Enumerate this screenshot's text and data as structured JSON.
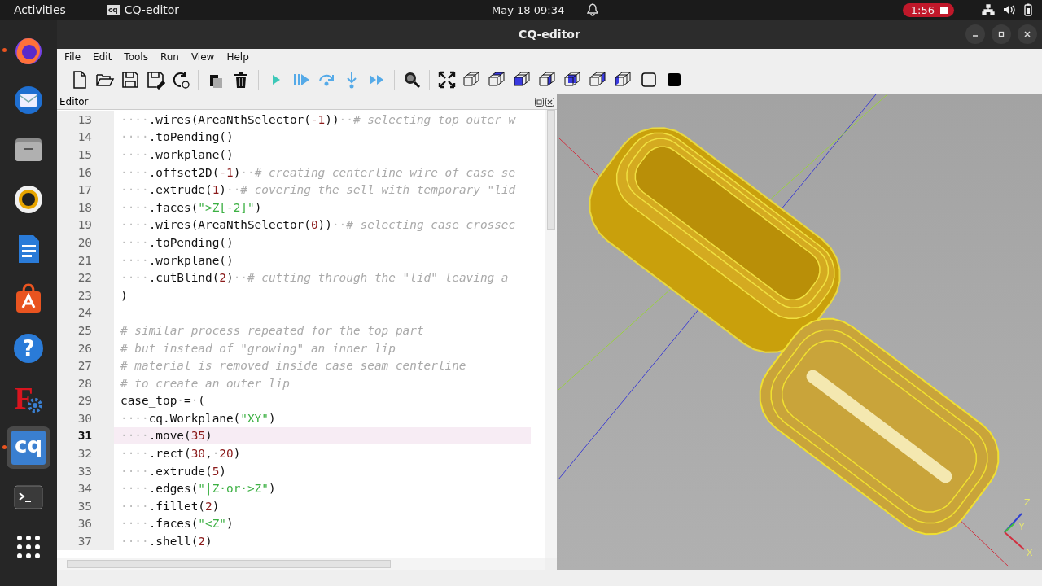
{
  "top_bar": {
    "activities": "Activities",
    "app_name": "CQ-editor",
    "app_icon_text": "cq",
    "clock": "May 18  09:34",
    "recording_time": "1:56"
  },
  "dock": [
    {
      "kind": "firefox",
      "running": true,
      "selected": false
    },
    {
      "kind": "mail",
      "running": false,
      "selected": false
    },
    {
      "kind": "files",
      "running": false,
      "selected": false
    },
    {
      "kind": "speaker",
      "running": false,
      "selected": false
    },
    {
      "kind": "writer",
      "running": false,
      "selected": false
    },
    {
      "kind": "store",
      "running": false,
      "selected": false
    },
    {
      "kind": "help",
      "label": "?",
      "running": false,
      "selected": false
    },
    {
      "kind": "freecad",
      "label": "F",
      "running": false,
      "selected": false
    },
    {
      "kind": "cq",
      "label": "cq",
      "running": true,
      "selected": true
    },
    {
      "kind": "terminal",
      "running": false,
      "selected": false
    },
    {
      "kind": "apps",
      "running": false,
      "selected": false
    }
  ],
  "window": {
    "title": "CQ-editor"
  },
  "menu": [
    "File",
    "Edit",
    "Tools",
    "Run",
    "View",
    "Help"
  ],
  "editor": {
    "title": "Editor",
    "lines": [
      {
        "number": "13",
        "current": false,
        "segments": [
          {
            "kind": "dots",
            "text": "····"
          },
          {
            "kind": "plain",
            "text": ".wires(AreaNthSelector("
          },
          {
            "kind": "number",
            "text": "-1"
          },
          {
            "kind": "plain",
            "text": "))"
          },
          {
            "kind": "dots",
            "text": "··"
          },
          {
            "kind": "comment",
            "text": "# selecting top outer w"
          }
        ]
      },
      {
        "number": "14",
        "current": false,
        "segments": [
          {
            "kind": "dots",
            "text": "····"
          },
          {
            "kind": "plain",
            "text": ".toPending()"
          }
        ]
      },
      {
        "number": "15",
        "current": false,
        "segments": [
          {
            "kind": "dots",
            "text": "····"
          },
          {
            "kind": "plain",
            "text": ".workplane()"
          }
        ]
      },
      {
        "number": "16",
        "current": false,
        "segments": [
          {
            "kind": "dots",
            "text": "····"
          },
          {
            "kind": "plain",
            "text": ".offset2D("
          },
          {
            "kind": "number",
            "text": "-1"
          },
          {
            "kind": "plain",
            "text": ")"
          },
          {
            "kind": "dots",
            "text": "··"
          },
          {
            "kind": "comment",
            "text": "# creating centerline wire of case se"
          }
        ]
      },
      {
        "number": "17",
        "current": false,
        "segments": [
          {
            "kind": "dots",
            "text": "····"
          },
          {
            "kind": "plain",
            "text": ".extrude("
          },
          {
            "kind": "number",
            "text": "1"
          },
          {
            "kind": "plain",
            "text": ")"
          },
          {
            "kind": "dots",
            "text": "··"
          },
          {
            "kind": "comment",
            "text": "# covering the sell with temporary \"lid"
          }
        ]
      },
      {
        "number": "18",
        "current": false,
        "segments": [
          {
            "kind": "dots",
            "text": "····"
          },
          {
            "kind": "plain",
            "text": ".faces("
          },
          {
            "kind": "string",
            "text": "\">Z[-2]\""
          },
          {
            "kind": "plain",
            "text": ")"
          }
        ]
      },
      {
        "number": "19",
        "current": false,
        "segments": [
          {
            "kind": "dots",
            "text": "····"
          },
          {
            "kind": "plain",
            "text": ".wires(AreaNthSelector("
          },
          {
            "kind": "number",
            "text": "0"
          },
          {
            "kind": "plain",
            "text": "))"
          },
          {
            "kind": "dots",
            "text": "··"
          },
          {
            "kind": "comment",
            "text": "# selecting case crossec"
          }
        ]
      },
      {
        "number": "20",
        "current": false,
        "segments": [
          {
            "kind": "dots",
            "text": "····"
          },
          {
            "kind": "plain",
            "text": ".toPending()"
          }
        ]
      },
      {
        "number": "21",
        "current": false,
        "segments": [
          {
            "kind": "dots",
            "text": "····"
          },
          {
            "kind": "plain",
            "text": ".workplane()"
          }
        ]
      },
      {
        "number": "22",
        "current": false,
        "segments": [
          {
            "kind": "dots",
            "text": "····"
          },
          {
            "kind": "plain",
            "text": ".cutBlind("
          },
          {
            "kind": "number",
            "text": "2"
          },
          {
            "kind": "plain",
            "text": ")"
          },
          {
            "kind": "dots",
            "text": "··"
          },
          {
            "kind": "comment",
            "text": "# cutting through the \"lid\" leaving a"
          }
        ]
      },
      {
        "number": "23",
        "current": false,
        "segments": [
          {
            "kind": "plain",
            "text": ")"
          }
        ]
      },
      {
        "number": "24",
        "current": false
      },
      {
        "number": "25",
        "current": false,
        "segments": [
          {
            "kind": "comment",
            "text": "# similar process repeated for the top part"
          }
        ]
      },
      {
        "number": "26",
        "current": false,
        "segments": [
          {
            "kind": "comment",
            "text": "# but instead of \"growing\" an inner lip"
          }
        ]
      },
      {
        "number": "27",
        "current": false,
        "segments": [
          {
            "kind": "comment",
            "text": "# material is removed inside case seam centerline"
          }
        ]
      },
      {
        "number": "28",
        "current": false,
        "segments": [
          {
            "kind": "comment",
            "text": "# to create an outer lip"
          }
        ]
      },
      {
        "number": "29",
        "current": false,
        "segments": [
          {
            "kind": "plain",
            "text": "case_top"
          },
          {
            "kind": "dots",
            "text": "·"
          },
          {
            "kind": "plain",
            "text": "="
          },
          {
            "kind": "dots",
            "text": "·"
          },
          {
            "kind": "plain",
            "text": "("
          }
        ]
      },
      {
        "number": "30",
        "current": false,
        "segments": [
          {
            "kind": "dots",
            "text": "····"
          },
          {
            "kind": "plain",
            "text": "cq.Workplane("
          },
          {
            "kind": "string",
            "text": "\"XY\""
          },
          {
            "kind": "plain",
            "text": ")"
          }
        ]
      },
      {
        "number": "31",
        "current": true,
        "segments": [
          {
            "kind": "dots",
            "text": "····"
          },
          {
            "kind": "plain",
            "text": ".move("
          },
          {
            "kind": "number",
            "text": "35"
          },
          {
            "kind": "plain",
            "text": ")"
          }
        ]
      },
      {
        "number": "32",
        "current": false,
        "segments": [
          {
            "kind": "dots",
            "text": "····"
          },
          {
            "kind": "plain",
            "text": ".rect("
          },
          {
            "kind": "number",
            "text": "30"
          },
          {
            "kind": "plain",
            "text": ","
          },
          {
            "kind": "dots",
            "text": "·"
          },
          {
            "kind": "number",
            "text": "20"
          },
          {
            "kind": "plain",
            "text": ")"
          }
        ]
      },
      {
        "number": "33",
        "current": false,
        "segments": [
          {
            "kind": "dots",
            "text": "····"
          },
          {
            "kind": "plain",
            "text": ".extrude("
          },
          {
            "kind": "number",
            "text": "5"
          },
          {
            "kind": "plain",
            "text": ")"
          }
        ]
      },
      {
        "number": "34",
        "current": false,
        "segments": [
          {
            "kind": "dots",
            "text": "····"
          },
          {
            "kind": "plain",
            "text": ".edges("
          },
          {
            "kind": "string",
            "text": "\"|Z·or·>Z\""
          },
          {
            "kind": "plain",
            "text": ")"
          }
        ]
      },
      {
        "number": "35",
        "current": false,
        "segments": [
          {
            "kind": "dots",
            "text": "····"
          },
          {
            "kind": "plain",
            "text": ".fillet("
          },
          {
            "kind": "number",
            "text": "2"
          },
          {
            "kind": "plain",
            "text": ")"
          }
        ]
      },
      {
        "number": "36",
        "current": false,
        "segments": [
          {
            "kind": "dots",
            "text": "····"
          },
          {
            "kind": "plain",
            "text": ".faces("
          },
          {
            "kind": "string",
            "text": "\"<Z\""
          },
          {
            "kind": "plain",
            "text": ")"
          }
        ]
      },
      {
        "number": "37",
        "current": false,
        "segments": [
          {
            "kind": "dots",
            "text": "····"
          },
          {
            "kind": "plain",
            "text": ".shell("
          },
          {
            "kind": "number",
            "text": "2"
          },
          {
            "kind": "plain",
            "text": ")"
          }
        ]
      }
    ]
  },
  "viewer": {
    "axis_labels": {
      "z": "Z",
      "y": "Y",
      "x": "X"
    }
  }
}
